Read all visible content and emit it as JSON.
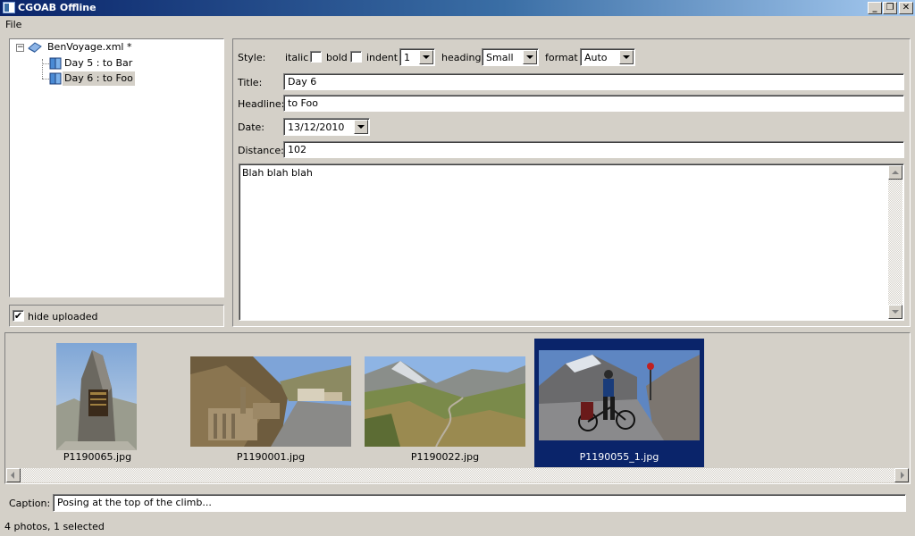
{
  "window": {
    "title": "CGOAB Offline",
    "minimize": "_",
    "restore": "❐",
    "close": "✕"
  },
  "menu": {
    "file": "File"
  },
  "tree": {
    "root": {
      "label": "BenVoyage.xml *",
      "expander": "−"
    },
    "children": [
      {
        "label": "Day 5 : to Bar"
      },
      {
        "label": "Day 6 : to Foo"
      }
    ]
  },
  "hide_uploaded": {
    "label": "hide uploaded",
    "checked": "✔"
  },
  "style_bar": {
    "label": "Style:",
    "italic": "italic",
    "bold": "bold",
    "indent": "indent",
    "indent_value": "1",
    "heading": "heading",
    "heading_value": "Small",
    "format": "format",
    "format_value": "Auto"
  },
  "fields": {
    "title_label": "Title:",
    "title_value": "Day 6",
    "headline_label": "Headline:",
    "headline_value": "to Foo",
    "date_label": "Date:",
    "date_value": "13/12/2010",
    "distance_label": "Distance:",
    "distance_value": "102"
  },
  "body_text": "Blah blah blah",
  "photos": [
    {
      "name": "P1190065.jpg"
    },
    {
      "name": "P1190001.jpg"
    },
    {
      "name": "P1190022.jpg"
    },
    {
      "name": "P1190055_1.jpg"
    }
  ],
  "caption": {
    "label": "Caption:",
    "value": "Posing at the top of the climb..."
  },
  "status": "4 photos, 1 selected",
  "colors": {
    "selection": "#0a246a",
    "face": "#d4d0c8"
  }
}
